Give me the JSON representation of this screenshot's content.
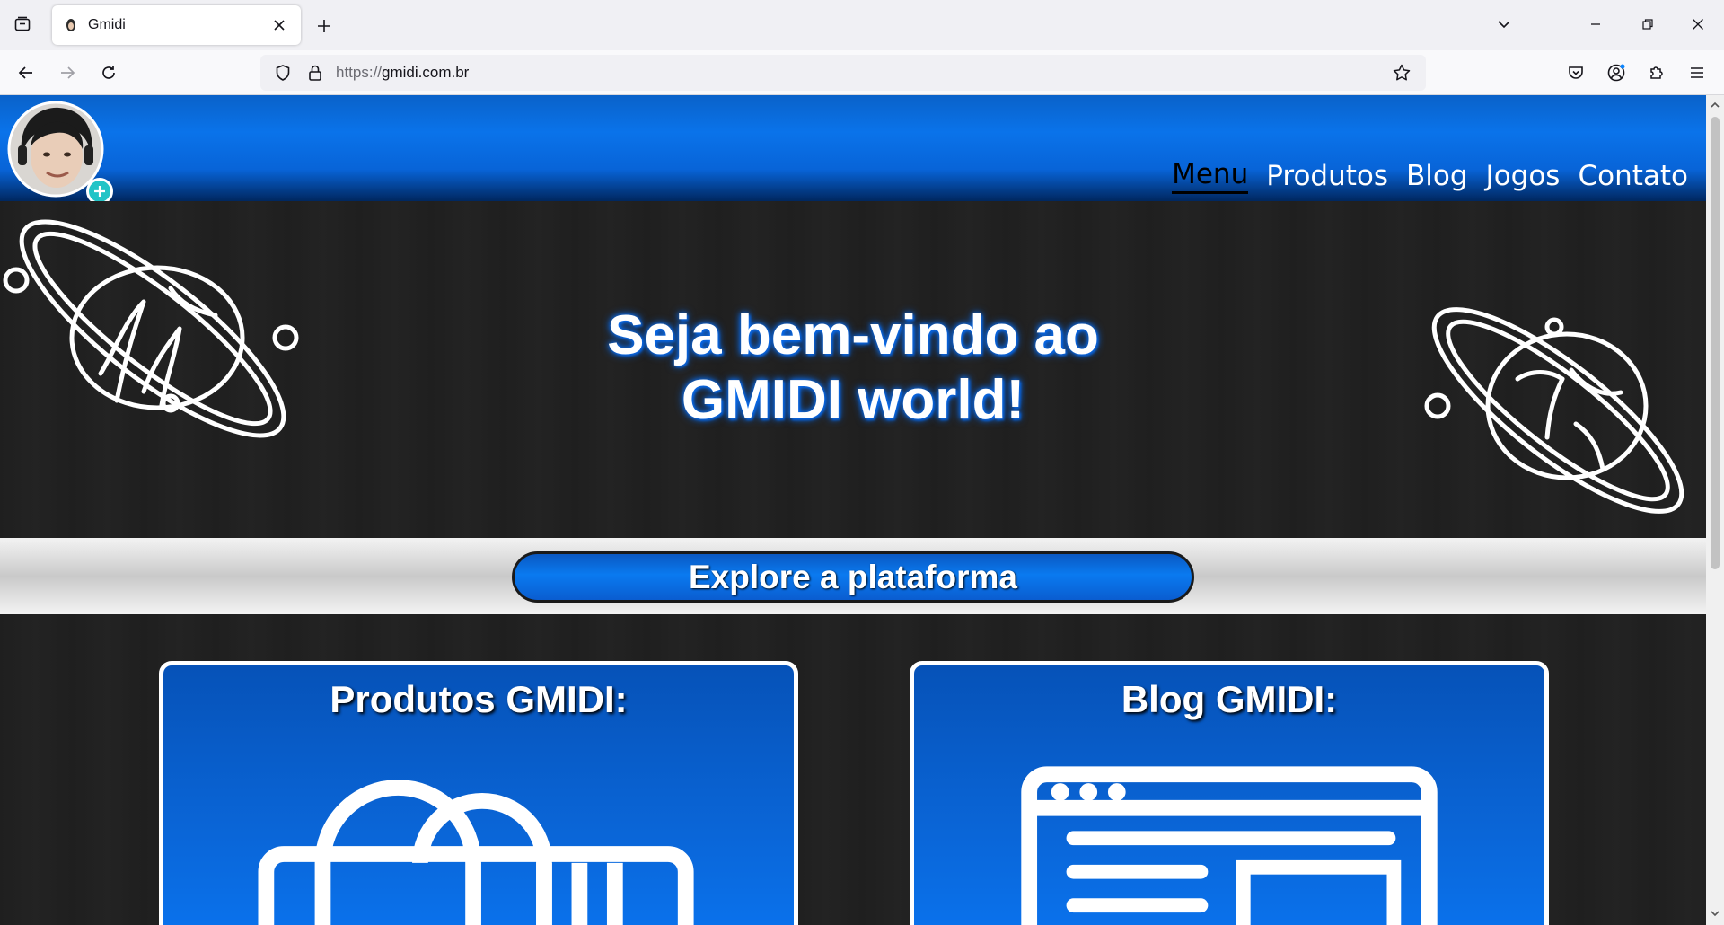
{
  "browser": {
    "tab_title": "Gmidi",
    "url_protocol": "https://",
    "url_host": "gmidi.com.br",
    "icons": {
      "tab_list": "tab-list-icon",
      "favicon": "gmidi-favicon",
      "tab_close": "close-icon",
      "new_tab": "plus-icon",
      "list_all_tabs": "chevron-down-icon",
      "minimize": "minimize-icon",
      "restore": "restore-icon",
      "close_window": "close-icon",
      "back": "arrow-left-icon",
      "forward": "arrow-right-icon",
      "reload": "reload-icon",
      "tracking_protection": "shield-icon",
      "secure": "lock-icon",
      "bookmark": "star-icon",
      "pocket": "pocket-icon",
      "account": "account-icon",
      "extensions": "puzzle-icon",
      "menu": "hamburger-icon"
    }
  },
  "site": {
    "nav": [
      {
        "label": "Menu",
        "active": true
      },
      {
        "label": "Produtos",
        "active": false
      },
      {
        "label": "Blog",
        "active": false
      },
      {
        "label": "Jogos",
        "active": false
      },
      {
        "label": "Contato",
        "active": false
      }
    ],
    "hero": {
      "line1": "Seja bem-vindo ao",
      "line2": "GMIDI world!"
    },
    "explore_button": "Explore a plataforma",
    "cards": [
      {
        "title": "Produtos GMIDI:",
        "illustration": "store-icon"
      },
      {
        "title": "Blog GMIDI:",
        "illustration": "browser-window-icon"
      }
    ],
    "colors": {
      "header_blue": "#0a73ea",
      "dark_bg": "#1f1f1f",
      "card_blue": "#0a66d8",
      "active_nav": "#000000"
    }
  }
}
